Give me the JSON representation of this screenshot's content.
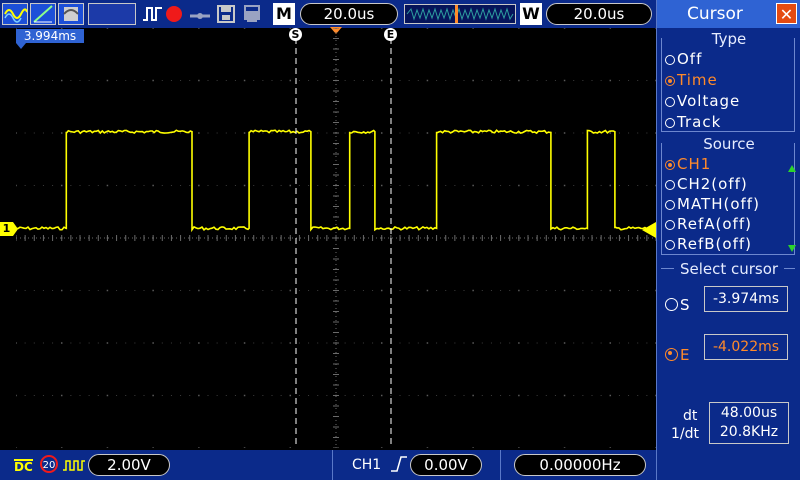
{
  "topbar": {
    "mode_badge": "M",
    "timebase": "20.0us",
    "window_badge": "W",
    "window_timebase": "20.0us"
  },
  "screen": {
    "trigger_offset": "3.994ms",
    "channel_marker": "1",
    "cursor_s_label": "S",
    "cursor_e_label": "E"
  },
  "bottombar": {
    "coupling": "DC",
    "bw_limit": "20",
    "volts_div": "2.00V",
    "trigger_source": "CH1",
    "trigger_level": "0.00V",
    "frequency": "0.00000Hz"
  },
  "sidebar": {
    "title": "Cursor",
    "type_header": "Type",
    "type_options": [
      "Off",
      "Time",
      "Voltage",
      "Track"
    ],
    "type_selected": "Time",
    "source_header": "Source",
    "source_options": [
      "CH1",
      "CH2(off)",
      "MATH(off)",
      "RefA(off)",
      "RefB(off)"
    ],
    "source_selected": "CH1",
    "select_header": "Select cursor",
    "s_label": "S",
    "s_value": "-3.974ms",
    "e_label": "E",
    "e_value": "-4.022ms",
    "dt_label": "dt",
    "dt_value": "48.00us",
    "inv_dt_label": "1/dt",
    "inv_dt_value": "20.8KHz"
  },
  "colors": {
    "trace": "#ffff00",
    "panel_blue": "#0b2a8a",
    "title_blue": "#2f63d3",
    "selected_orange": "#ff8a2a",
    "close_red": "#e54b12"
  },
  "waveform": {
    "channel": "CH1",
    "high_divs": 2.2,
    "low_divs": 0.2,
    "edges_x_divs": [
      1.1,
      3.85,
      5.1,
      6.45,
      7.3,
      7.85,
      9.2,
      11.7,
      12.5,
      13.1
    ]
  }
}
